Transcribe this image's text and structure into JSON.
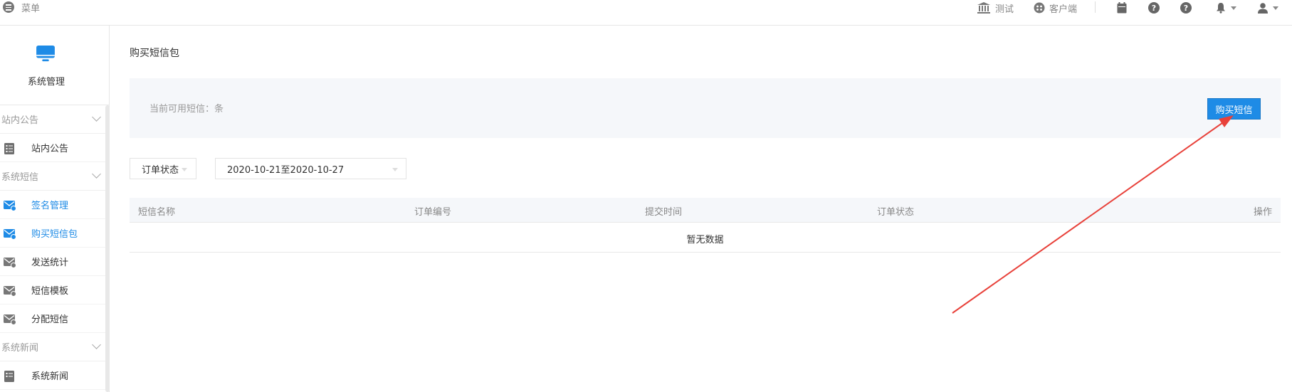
{
  "topbar": {
    "menu_label": "菜单",
    "items": [
      {
        "label": "测试",
        "icon": "bank-icon"
      },
      {
        "label": "客户端",
        "icon": "client-icon"
      }
    ],
    "right_icons": [
      "calendar-icon",
      "help-icon",
      "help-icon",
      "bell-icon",
      "user-icon"
    ]
  },
  "sidebar": {
    "module_title": "系统管理",
    "module_icon": "monitor-icon",
    "groups": [
      {
        "title": "站内公告",
        "items": [
          {
            "label": "站内公告",
            "icon": "document-icon",
            "active": false
          }
        ]
      },
      {
        "title": "系统短信",
        "items": [
          {
            "label": "签名管理",
            "icon": "mail-icon",
            "active": true
          },
          {
            "label": "购买短信包",
            "icon": "mail-icon",
            "active": true
          },
          {
            "label": "发送统计",
            "icon": "mail-icon",
            "active": false
          },
          {
            "label": "短信模板",
            "icon": "mail-icon",
            "active": false
          },
          {
            "label": "分配短信",
            "icon": "mail-icon",
            "active": false
          }
        ]
      },
      {
        "title": "系统新闻",
        "items": [
          {
            "label": "系统新闻",
            "icon": "document-icon",
            "active": false
          }
        ]
      }
    ]
  },
  "main": {
    "page_title": "购买短信包",
    "info_text": "当前可用短信：条",
    "buy_button": "购买短信",
    "filters": {
      "status_label": "订单状态",
      "date_range": "2020-10-21至2020-10-27"
    },
    "table": {
      "columns": [
        "短信名称",
        "订单编号",
        "提交时间",
        "订单状态",
        "操作"
      ],
      "empty_text": "暂无数据"
    }
  },
  "colors": {
    "accent": "#1e8be6",
    "annotation_arrow": "#e8413a",
    "panel_bg": "#f5f7fa"
  }
}
